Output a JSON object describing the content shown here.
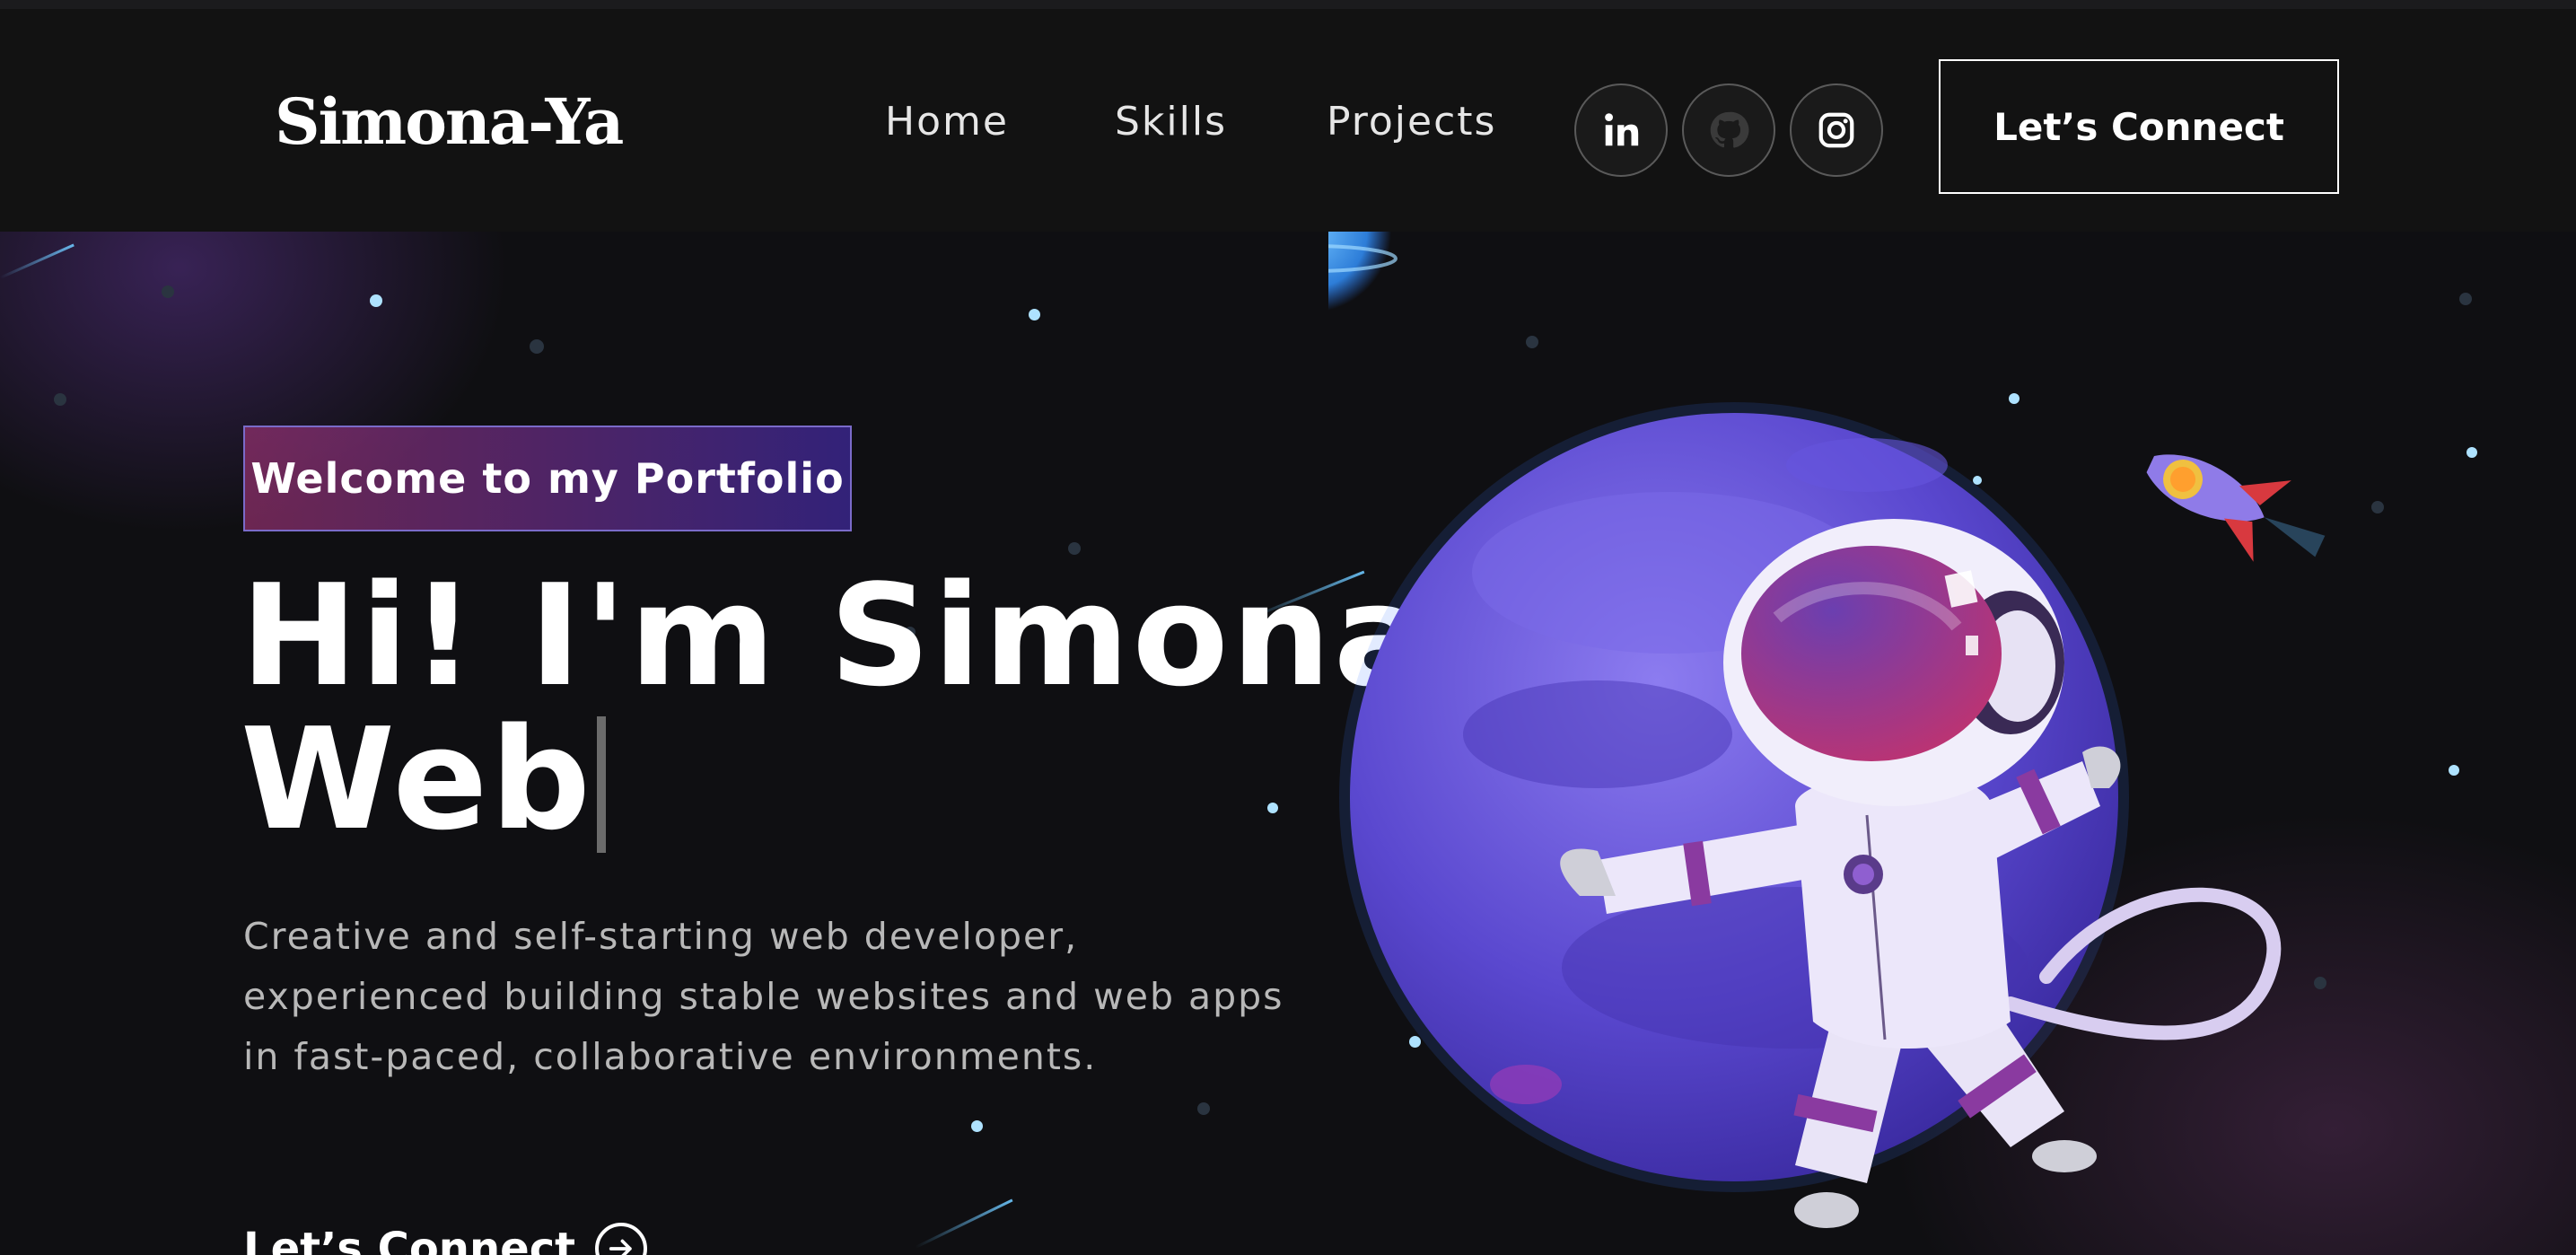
{
  "header": {
    "logo": "Simona-Ya",
    "nav": [
      {
        "label": "Home"
      },
      {
        "label": "Skills"
      },
      {
        "label": "Projects"
      }
    ],
    "social": [
      {
        "icon": "linkedin-icon"
      },
      {
        "icon": "github-icon"
      },
      {
        "icon": "instagram-icon"
      }
    ],
    "connect_label": "Let’s Connect"
  },
  "hero": {
    "tagline": "Welcome to my Portfolio",
    "headline_line1": "Hi! I'm Simona",
    "headline_line2": "Web",
    "description": "Creative and self-starting web developer, experienced building stable websites and web apps in fast-paced, collaborative environments.",
    "cta_label": "Let’s Connect"
  },
  "colors": {
    "background": "#121212",
    "tagline_gradient_start": "#aa367c",
    "tagline_gradient_end": "#4a2fbd",
    "planet": "#6a55d6"
  }
}
